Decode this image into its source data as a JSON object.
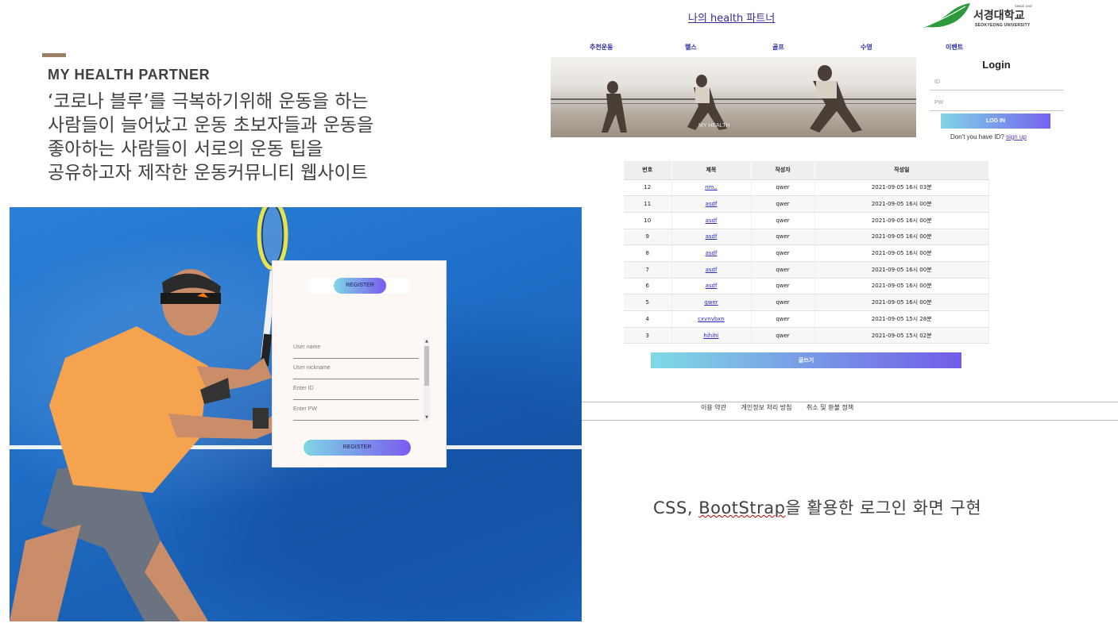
{
  "slide": {
    "heading": "MY HEALTH PARTNER",
    "description_lines": [
      "‘코로나 블루’를 극복하기위해 운동을 하는",
      "사람들이 늘어났고 운동 초보자들과 운동을",
      "좋아하는 사람들이 서로의 운동 팁을",
      "공유하고자 제작한 운동커뮤니티 웹사이트"
    ],
    "bottom_caption_prefix": "CSS, ",
    "bottom_caption_word": "BootStrap",
    "bottom_caption_suffix": "을 활용한 로그인 화면 구현",
    "accent_color": "#9b8266"
  },
  "register": {
    "top_button": "REGISTER",
    "fields": [
      "User name",
      "User nickname",
      "Enter ID",
      "Enter PW"
    ],
    "bottom_button": "REGISTER"
  },
  "site": {
    "title": "나의 health 파트너",
    "logo": {
      "name_kr": "서경대학교",
      "name_en": "SEOKYEONG UNIVERSITY",
      "since": "SINCE 1947"
    },
    "nav": [
      "추천운동",
      "헬스",
      "골프",
      "수영",
      "이벤트"
    ],
    "carousel_caption": "MY HEALTH"
  },
  "login": {
    "title": "Login",
    "id_placeholder": "ID",
    "pw_placeholder": "PW",
    "button": "LOG IN",
    "signup_prompt": "Don't you have ID?",
    "signup_link": "sign up"
  },
  "board": {
    "columns": [
      "번호",
      "제목",
      "작성자",
      "작성일"
    ],
    "rows": [
      [
        "12",
        "nm,.",
        "qwer",
        "2021-09-05 16시 03분"
      ],
      [
        "11",
        "asdf",
        "qwer",
        "2021-09-05 16시 00분"
      ],
      [
        "10",
        "asdf",
        "qwer",
        "2021-09-05 16시 00분"
      ],
      [
        "9",
        "asdf",
        "qwer",
        "2021-09-05 16시 00분"
      ],
      [
        "8",
        "asdf",
        "qwer",
        "2021-09-05 16시 00분"
      ],
      [
        "7",
        "asdf",
        "qwer",
        "2021-09-05 16시 00분"
      ],
      [
        "6",
        "asdf",
        "qwer",
        "2021-09-05 16시 00분"
      ],
      [
        "5",
        "qwer",
        "qwer",
        "2021-09-05 16시 00분"
      ],
      [
        "4",
        "cxvnvbxn",
        "qwer",
        "2021-09-05 15시 28분"
      ],
      [
        "3",
        "hihihi",
        "qwer",
        "2021-09-05 15시 02분"
      ]
    ],
    "write_button": "글쓰기"
  },
  "footer": {
    "links": [
      "이용 약관",
      "개인정보 처리 방침",
      "취소 및 환불 정책"
    ]
  }
}
